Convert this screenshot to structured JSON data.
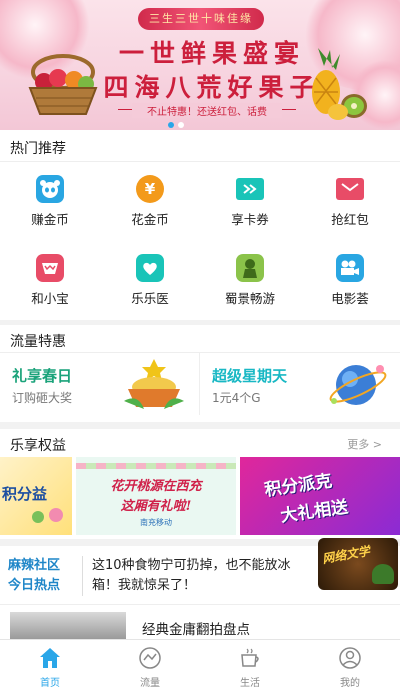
{
  "banner": {
    "ribbon": "三生三世十味佳缘",
    "headline_1": "一世鲜果盛宴",
    "headline_2": "四海八荒好果子",
    "promo": "不止特惠！还送红包、话费",
    "dots": 2,
    "active_dot": 1
  },
  "hot": {
    "title": "热门推荐",
    "items": [
      {
        "label": "赚金币",
        "icon": "panda-icon",
        "color": "#29a6e2"
      },
      {
        "label": "花金币",
        "icon": "yuan-coin-icon",
        "color": "#f39a1b"
      },
      {
        "label": "享卡券",
        "icon": "ticket-icon",
        "color": "#19c4b8"
      },
      {
        "label": "抢红包",
        "icon": "red-envelope-icon",
        "color": "#e84c67"
      },
      {
        "label": "和小宝",
        "icon": "bowl-icon",
        "color": "#e84c67"
      },
      {
        "label": "乐乐医",
        "icon": "hands-heart-icon",
        "color": "#19c4b8"
      },
      {
        "label": "蜀景畅游",
        "icon": "buddha-icon",
        "color": "#8bc34a"
      },
      {
        "label": "电影荟",
        "icon": "camera-icon",
        "color": "#29a6e2"
      }
    ]
  },
  "flow": {
    "title": "流量特惠",
    "cards": [
      {
        "title": "礼享春日",
        "subtitle": "订购砸大奖",
        "title_color": "#1aa37a",
        "icon": "gift-basket-icon"
      },
      {
        "title": "超级星期天",
        "subtitle": "1元4个G",
        "title_color": "#19b8c4",
        "icon": "planet-icon"
      }
    ]
  },
  "benefits": {
    "title": "乐享权益",
    "more": "更多 >",
    "cards": [
      {
        "text": "积分益"
      },
      {
        "text": "花开桃源在西充",
        "text2": "这厢有礼啦!",
        "tag": "南充移动"
      },
      {
        "text": "积分派克",
        "text2": "大礼相送"
      }
    ]
  },
  "hotspot": {
    "badge_line1": "麻辣社区",
    "badge_line2": "今日热点",
    "headline": "这10种食物宁可扔掉，也不能放冰箱！我就惊呆了！",
    "article_title": "经典金庸翻拍盘点",
    "overlay_text": "网络文学"
  },
  "nav": {
    "items": [
      {
        "label": "首页",
        "icon": "home-icon",
        "active": true
      },
      {
        "label": "流量",
        "icon": "flow-chart-icon",
        "active": false
      },
      {
        "label": "生活",
        "icon": "coffee-cup-icon",
        "active": false
      },
      {
        "label": "我的",
        "icon": "profile-icon",
        "active": false
      }
    ]
  },
  "colors": {
    "accent": "#2aa6e8",
    "banner_red": "#cc1f3c"
  }
}
